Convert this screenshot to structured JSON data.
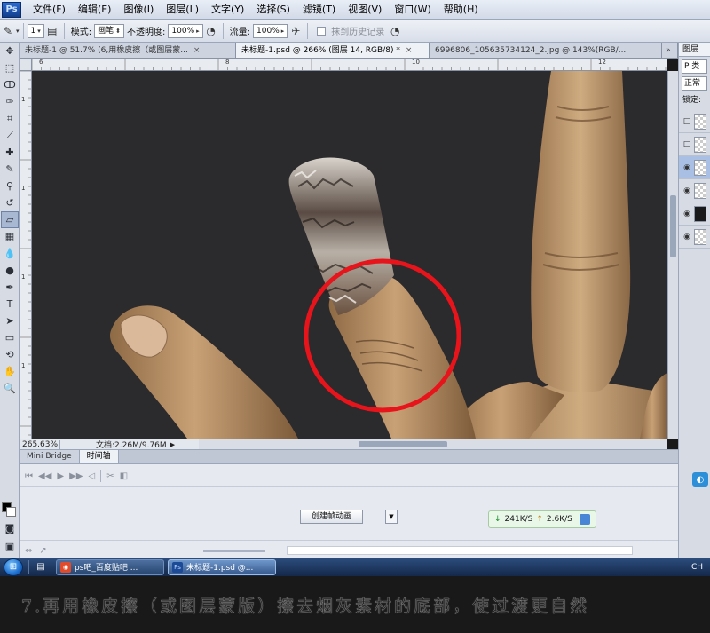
{
  "app": {
    "logo": "Ps",
    "menu": [
      "文件(F)",
      "编辑(E)",
      "图像(I)",
      "图层(L)",
      "文字(Y)",
      "选择(S)",
      "滤镜(T)",
      "视图(V)",
      "窗口(W)",
      "帮助(H)"
    ]
  },
  "options": {
    "brush_size": "1",
    "mode_label": "模式:",
    "mode_value": "画笔",
    "opacity_label": "不透明度:",
    "opacity_value": "100%",
    "flow_label": "流量:",
    "flow_value": "100%",
    "history_label": "抹到历史记录"
  },
  "doc_tabs": [
    {
      "label": "未标题-1 @ 51.7% (6,用橡皮擦（或图层蒙...",
      "active": false
    },
    {
      "label": "未标题-1.psd @ 266% (图层 14, RGB/8) *",
      "active": true
    },
    {
      "label": "6996806_105635734124_2.jpg @ 143%(RGB/...",
      "active": false
    }
  ],
  "ruler": {
    "h_labels": [
      "6",
      "8",
      "10",
      "12"
    ],
    "v_labels": [
      "1",
      "1",
      "1",
      "1"
    ]
  },
  "status": {
    "zoom": "265.63%",
    "doc_info": "文档:2.26M/9.76M"
  },
  "timeline": {
    "tabs": [
      "Mini Bridge",
      "时间轴"
    ],
    "create_button": "创建帧动画"
  },
  "netspeed": {
    "down": "241K/S",
    "up": "2.6K/S"
  },
  "layers_panel": {
    "tab": "图层",
    "kind_field": "P 类",
    "blend_field": "正常",
    "lock_label": "锁定:"
  },
  "taskbar": {
    "items": [
      {
        "label": "ps吧_百度贴吧 ...",
        "active": false
      },
      {
        "label": "未标题-1.psd @...",
        "active": true
      }
    ],
    "tray": "CH"
  },
  "caption": "7.再用橡皮擦（或图层蒙版）擦去烟灰素材的底部，使过渡更自然",
  "colors": {
    "canvas_bg": "#2b2a2c",
    "highlight_circle": "#e8141b",
    "skin": "#c29a6f"
  }
}
